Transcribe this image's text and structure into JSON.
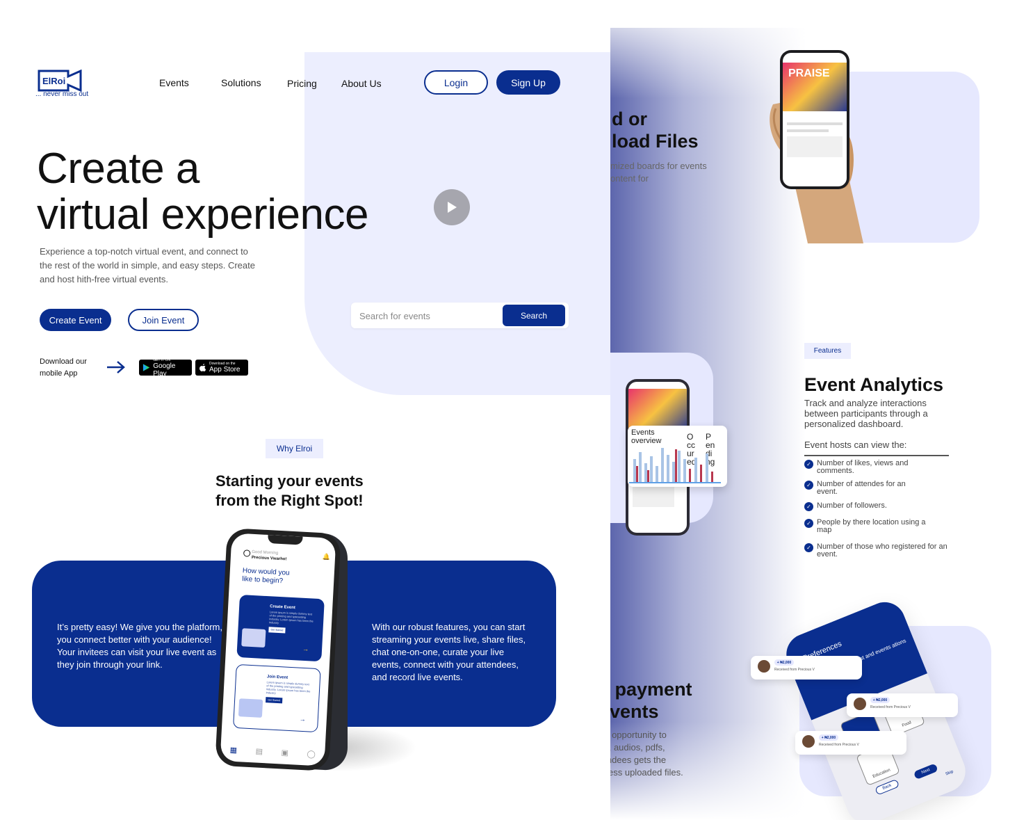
{
  "brand": {
    "logo_text": "ElRoi",
    "tagline": "... never miss out"
  },
  "nav": {
    "items": [
      "Events",
      "Solutions",
      "Pricing",
      "About Us"
    ],
    "login": "Login",
    "signup": "Sign Up"
  },
  "hero": {
    "title_line1": "Create a",
    "title_line2": "virtual experience",
    "subtitle": "Experience a top-notch virtual event, and connect to the rest of the world in simple, and easy steps. Create and host hith-free virtual events.",
    "create_button": "Create Event",
    "join_button": "Join Event",
    "download_line1": "Download our",
    "download_line2": "mobile App",
    "google_play_small": "GET IT ON",
    "google_play_big": "Google Play",
    "app_store_small": "Download on the",
    "app_store_big": "App Store"
  },
  "search": {
    "placeholder": "Search for events",
    "button": "Search"
  },
  "why": {
    "tag": "Why Elroi",
    "title_line1": "Starting your events",
    "title_line2": "from the Right Spot!",
    "left_text": "It’s pretty easy! We give you the platform, you connect better with your audience! Your invitees can visit your live event as they join through your link.",
    "right_text": "With our robust features, you can start streaming your events live, share files, chat one-on-one, curate your live events, connect with your attendees, and record live events."
  },
  "phone_app": {
    "greeting": "Good Morning",
    "user": "Precious Vwarho!",
    "question_line1": "How would you",
    "question_line2": "like to begin?",
    "card1_title": "Create Event",
    "card1_body": "Lorem ipsum is simply dummy text of the printing and typesetting industry. Lorem Ipsum has been the industry",
    "card1_button": "Get Started",
    "card2_title": "Join Event",
    "card2_body": "Lorem ipsum is simply dummy text of the printing and typesetting industry. Lorem Ipsum has been the industry",
    "card2_button": "Get Started"
  },
  "upload": {
    "heading_line1": "d or",
    "heading_line2": "load Files",
    "sub_line1": "mized boards for events",
    "sub_line2": "ontent for"
  },
  "features": {
    "tag": "Features",
    "title": "Event Analytics",
    "subtitle": "Track and analyze interactions between participants through a personalized dashboard.",
    "hosts_label": "Event hosts can view the:",
    "items": [
      "Number of likes, views and comments.",
      "Number of attendes for an event.",
      "Number of followers.",
      "People by there location using a map",
      "Number of those who registered for an event."
    ]
  },
  "chart_card": {
    "title": "Events overview",
    "legend1": "Occured",
    "legend2": "Pending"
  },
  "payment": {
    "heading_line1": "e payment",
    "heading_line2": "events",
    "sub_lines": [
      "he opportunity to",
      "os, audios, pdfs,",
      "tendees gets the",
      "ccess uploaded files."
    ]
  },
  "preferences": {
    "title": "Preferences",
    "subtitle": "your interest and events ations",
    "tiles": [
      "Religion",
      "Food",
      "Education"
    ],
    "back": "Back",
    "next": "Next",
    "skip": "Skip",
    "notif_amount": "+ ₦2,000",
    "notif_desc": "Received from Precious V"
  },
  "colors": {
    "primary": "#0a2e8f",
    "light_blue": "#eceefe",
    "text": "#111111"
  }
}
